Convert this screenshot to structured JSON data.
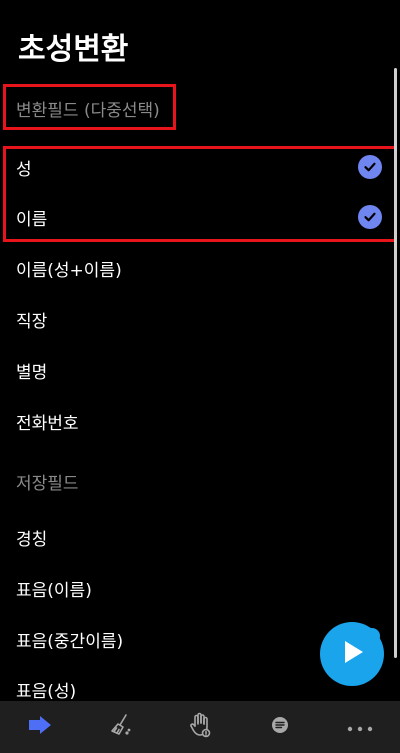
{
  "title": "초성변환",
  "convert_section": {
    "header": "변환필드 (다중선택)",
    "items": [
      {
        "label": "성",
        "checked": true
      },
      {
        "label": "이름",
        "checked": true
      },
      {
        "label": "이름(성+이름)",
        "checked": false
      },
      {
        "label": "직장",
        "checked": false
      },
      {
        "label": "별명",
        "checked": false
      },
      {
        "label": "전화번호",
        "checked": false
      }
    ]
  },
  "save_section": {
    "header": "저장필드",
    "items": [
      {
        "label": "경칭"
      },
      {
        "label": "표음(이름)"
      },
      {
        "label": "표음(중간이름)"
      },
      {
        "label": "표음(성)"
      }
    ]
  },
  "colors": {
    "background": "#000000",
    "highlight": "#e8141c",
    "check": "#6f86f0",
    "fab": "#1aa4ec",
    "bottom_bar": "#1f1f1f",
    "active_icon": "#4d6ef5"
  },
  "bottom_nav": [
    {
      "icon": "arrow-right-icon",
      "active": true
    },
    {
      "icon": "brush-icon",
      "active": false
    },
    {
      "icon": "hand-gesture-icon",
      "active": false
    },
    {
      "icon": "message-icon",
      "active": false
    },
    {
      "icon": "more-icon",
      "active": false
    }
  ],
  "fab_icon": "play-icon"
}
